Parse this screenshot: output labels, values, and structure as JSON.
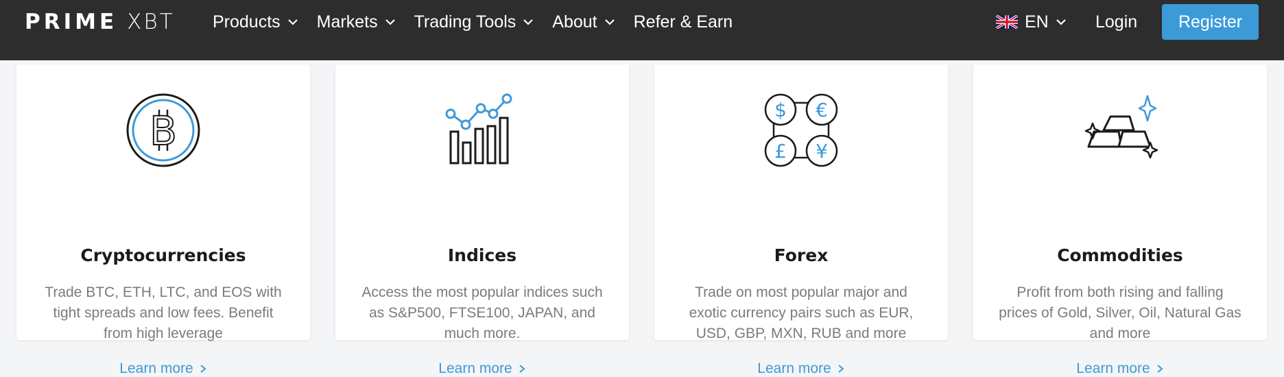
{
  "header": {
    "logo_prime": "PRIME",
    "logo_xbt": "XBT",
    "nav": [
      {
        "label": "Products",
        "icon": "chevron-down-icon"
      },
      {
        "label": "Markets",
        "icon": "chevron-down-icon"
      },
      {
        "label": "Trading Tools",
        "icon": "chevron-down-icon"
      },
      {
        "label": "About",
        "icon": "chevron-down-icon"
      },
      {
        "label": "Refer & Earn"
      }
    ],
    "language": "EN",
    "login": "Login",
    "register": "Register"
  },
  "colors": {
    "nav_bg": "#2d2d2d",
    "accent": "#3d9ad9",
    "page_bg": "#f4f5f7",
    "card_bg": "#ffffff",
    "text_dark": "#1b1b1b",
    "text_muted": "#7b7b7b"
  },
  "cards": [
    {
      "icon": "bitcoin-icon",
      "title": "Cryptocurrencies",
      "description": "Trade BTC, ETH, LTC, and EOS with tight spreads and low fees. Benefit from high leverage",
      "link": "Learn more"
    },
    {
      "icon": "chart-icon",
      "title": "Indices",
      "description": "Access the most popular indices such as S&P500, FTSE100, JAPAN, and much more.",
      "link": "Learn more"
    },
    {
      "icon": "currency-icon",
      "title": "Forex",
      "description": "Trade on most popular major and exotic currency pairs such as EUR, USD, GBP, MXN, RUB and more",
      "link": "Learn more"
    },
    {
      "icon": "gold-bars-icon",
      "title": "Commodities",
      "description": "Profit from both rising and falling prices of Gold, Silver, Oil, Natural Gas and more",
      "link": "Learn more"
    }
  ]
}
